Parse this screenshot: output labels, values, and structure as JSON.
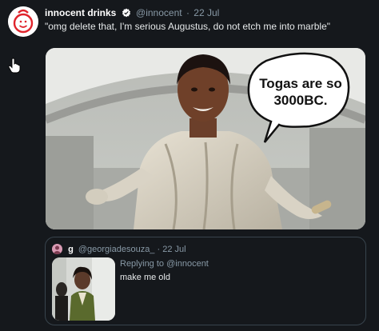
{
  "tweet": {
    "display_name": "innocent drinks",
    "handle": "@innocent",
    "separator": "·",
    "date": "22 Jul",
    "text": "\"omg delete that, I'm serious Augustus, do not etch me into marble\""
  },
  "media": {
    "speech_bubble_text": "Togas are so 3000BC."
  },
  "quoted_tweet": {
    "display_name": "g",
    "handle": "@georgiadesouza_",
    "separator": "·",
    "date": "22 Jul",
    "replying_prefix": "Replying to",
    "replying_to": "@innocent",
    "text": "make me old"
  },
  "colors": {
    "background": "#15181c",
    "secondary_text": "#8899a6",
    "verified_badge": "#ffffff",
    "border": "#38444d"
  },
  "icons": [
    "innocent-logo-avatar",
    "verified-badge-icon",
    "hand-pointer-cursor-icon",
    "quoted-user-avatar"
  ]
}
